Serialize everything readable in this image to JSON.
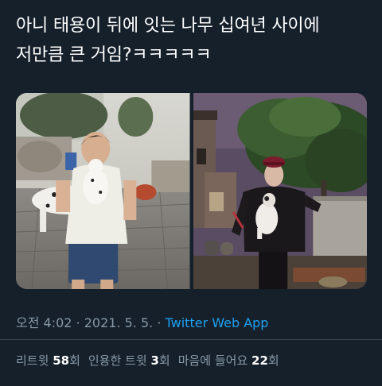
{
  "tweet": {
    "text_line1": "아니 태용이 뒤에 잇는 나무 십여년 사이에",
    "text_line2": "저만큼 큰 거임?ㅋㅋㅋㅋㅋ"
  },
  "meta": {
    "time": "오전 4:02",
    "separator": " · ",
    "date": "2021. 5. 5.",
    "source": "Twitter Web App"
  },
  "stats": {
    "retweets_label": "리트윗",
    "retweets_count": "58",
    "retweets_unit": "회",
    "quotes_label": "인용한 트윗",
    "quotes_count": "3",
    "quotes_unit": "회",
    "likes_label": "마음에 들어요",
    "likes_count": "22",
    "likes_unit": "회"
  },
  "colors": {
    "background": "#15202b",
    "muted": "#8899a6",
    "link": "#1da1f2",
    "divider": "#38444d"
  }
}
